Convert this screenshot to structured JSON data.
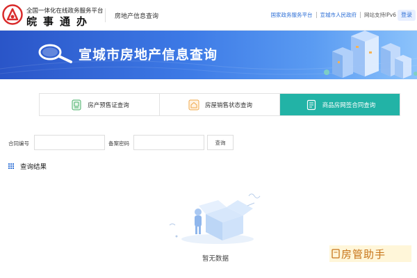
{
  "header": {
    "logo_tagline": "全国一体化在线政务服务平台",
    "logo_name": "皖事通办",
    "title": "房地产信息查询",
    "links": [
      "国家政务服务平台",
      "宣城市人民政府"
    ],
    "ipv6_text": "网站支持IPv6",
    "login_label": "登录"
  },
  "banner": {
    "title": "宣城市房地产信息查询"
  },
  "tabs": [
    {
      "label": "房产预售证查询",
      "icon": "document-check-icon",
      "active": false
    },
    {
      "label": "房屋销售状态查询",
      "icon": "house-icon",
      "active": false
    },
    {
      "label": "商品房网签合同查询",
      "icon": "contract-icon",
      "active": true
    }
  ],
  "search": {
    "contract_no_label": "合同编号",
    "contract_no_value": "",
    "filing_pwd_label": "备案密码",
    "filing_pwd_value": "",
    "query_label": "查询"
  },
  "results": {
    "heading": "查询结果",
    "empty_text": "暂无数据"
  },
  "watermark": {
    "text": "房管助手"
  },
  "colors": {
    "accent_teal": "#22b3a6",
    "link_blue": "#2d6fd6",
    "banner_blue": "#3d7ae6"
  }
}
